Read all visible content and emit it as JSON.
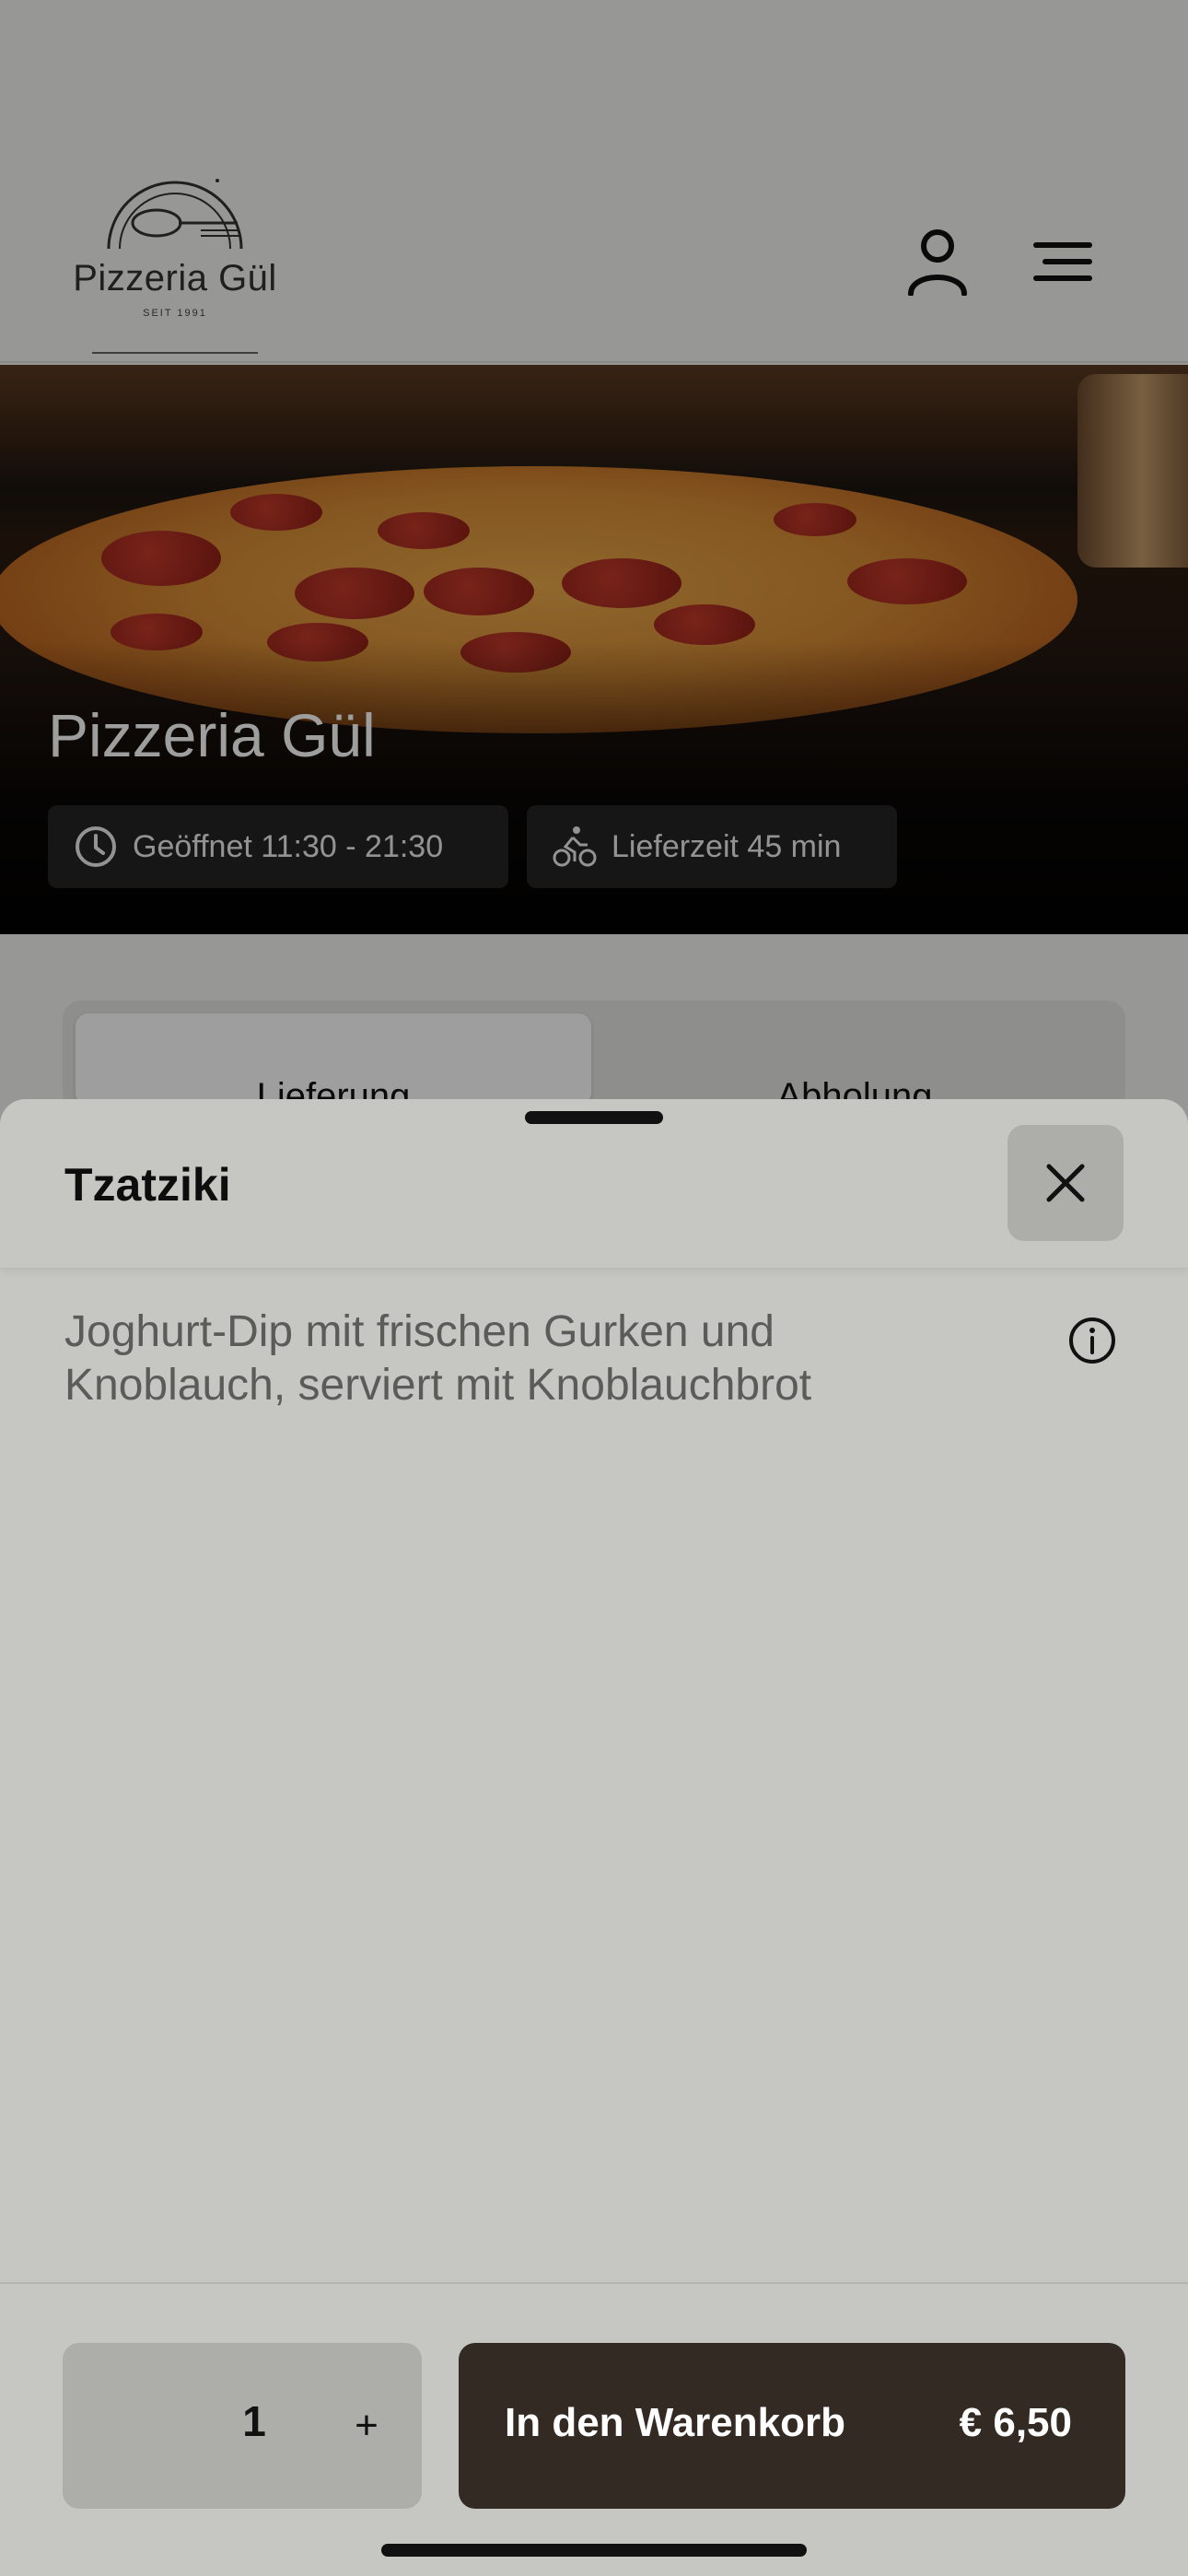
{
  "header": {
    "logo_name": "Pizzeria Gül",
    "logo_sub": "SEIT 1991",
    "icons": [
      "user-icon",
      "menu-icon"
    ]
  },
  "hero": {
    "title": "Pizzeria Gül",
    "opening_hours": "Geöffnet 11:30 - 21:30",
    "delivery_time": "Lieferzeit 45 min"
  },
  "tabs": [
    {
      "label": "Lieferung",
      "active": true
    },
    {
      "label": "Abholung",
      "active": false
    }
  ],
  "sheet": {
    "title": "Tzatziki",
    "description": "Joghurt-Dip mit frischen Gurken und Knoblauch, serviert mit Knoblauchbrot",
    "quantity": "1",
    "plus_label": "+",
    "add_to_cart_label": "In den Warenkorb",
    "price": "€ 6,50"
  },
  "colors": {
    "accent_button": "#342a24",
    "sheet_bg": "#c6c6c2"
  }
}
